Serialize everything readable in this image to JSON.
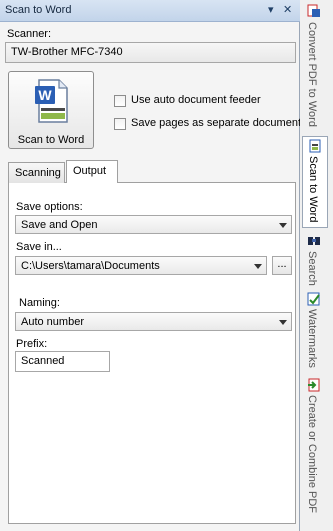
{
  "panel": {
    "title": "Scan to Word",
    "pin_glyph": "▾",
    "close_glyph": "✕"
  },
  "scanner": {
    "label": "Scanner:",
    "value": "TW-Brother MFC-7340"
  },
  "scan_button": {
    "label": "Scan to Word"
  },
  "options": {
    "auto_feeder": "Use auto document feeder",
    "separate_docs": "Save pages as separate documents"
  },
  "tabs": [
    {
      "label": "Scanning"
    },
    {
      "label": "Output"
    }
  ],
  "output": {
    "save_options_label": "Save options:",
    "save_options_value": "Save and Open",
    "save_in_label": "Save in...",
    "save_in_value": "C:\\Users\\tamara\\Documents",
    "browse_label": "...",
    "naming_label": "Naming:",
    "naming_value": "Auto number",
    "prefix_label": "Prefix:",
    "prefix_value": "Scanned"
  },
  "sidebar": {
    "items": [
      {
        "label": "Convert PDF to Word",
        "icon": "pdf-to-word-icon"
      },
      {
        "label": "Scan to Word",
        "icon": "scan-to-word-icon"
      },
      {
        "label": "Search",
        "icon": "search-icon"
      },
      {
        "label": "Watermarks",
        "icon": "watermark-icon"
      },
      {
        "label": "Create or Combine PDF",
        "icon": "combine-pdf-icon"
      }
    ]
  },
  "colors": {
    "titlebar": "#c8d8ec",
    "word_blue": "#2b5fb4",
    "pdf_red": "#c8282a"
  }
}
